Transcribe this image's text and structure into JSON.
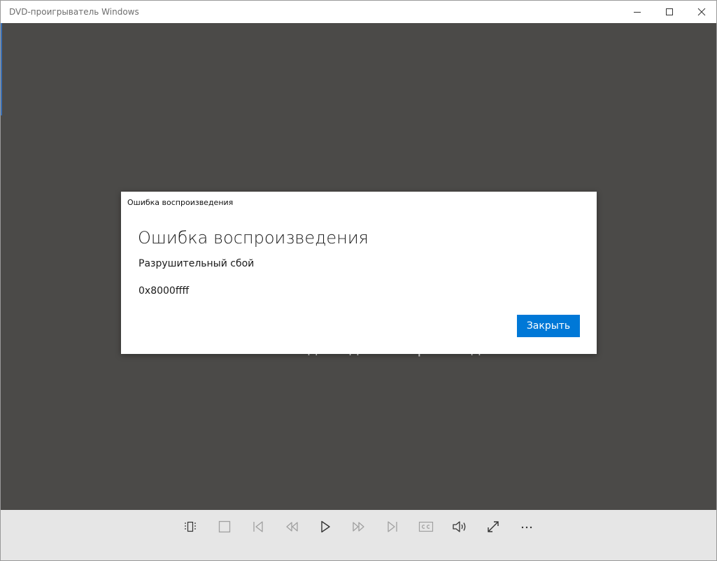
{
  "window": {
    "title": "DVD-проигрыватель Windows"
  },
  "content": {
    "insert_message": "Вставьте DVD-диск для воспроизведения."
  },
  "dialog": {
    "caption": "Ошибка воспроизведения",
    "heading": "Ошибка воспроизведения",
    "message": "Разрушительный сбой",
    "code": "0x8000ffff",
    "close_button_label": "Закрыть"
  },
  "controls": [
    {
      "name": "menu-icon",
      "enabled": true
    },
    {
      "name": "stop-icon",
      "enabled": false
    },
    {
      "name": "previous-chapter-icon",
      "enabled": false
    },
    {
      "name": "rewind-icon",
      "enabled": false
    },
    {
      "name": "play-icon",
      "enabled": true
    },
    {
      "name": "fast-forward-icon",
      "enabled": false
    },
    {
      "name": "next-chapter-icon",
      "enabled": false
    },
    {
      "name": "captions-icon",
      "enabled": false
    },
    {
      "name": "volume-icon",
      "enabled": true
    },
    {
      "name": "full-screen-icon",
      "enabled": true
    },
    {
      "name": "more-options-icon",
      "enabled": true
    }
  ],
  "colors": {
    "accent": "#0078d7",
    "content_background": "#4b4a48",
    "control_bar": "#e6e6e6",
    "control_icon": "#333333",
    "control_icon_disabled": "#a0a0a0"
  }
}
